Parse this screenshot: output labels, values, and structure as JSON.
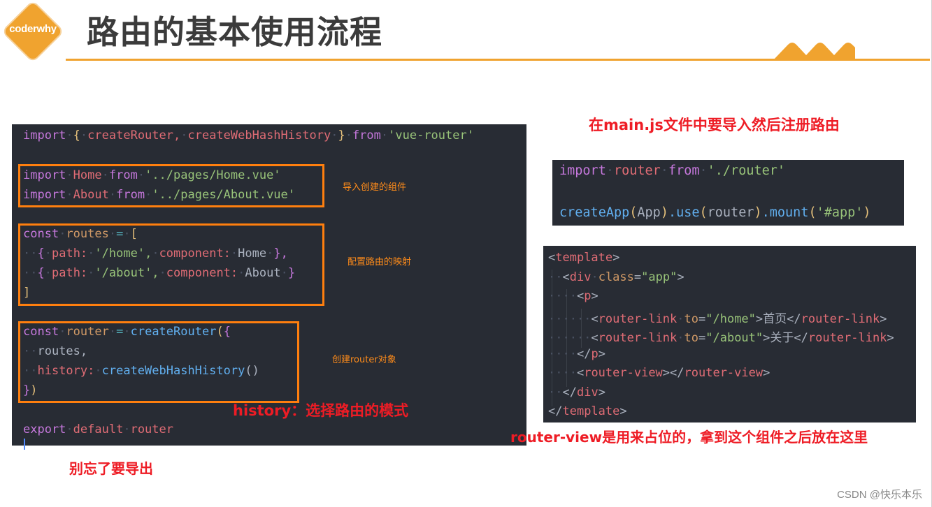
{
  "header": {
    "logo_text": "coderwhy",
    "title": "路由的基本使用流程",
    "accent_color": "#f0a32f"
  },
  "router_file": {
    "lines": {
      "l1": [
        "import",
        "{",
        "createRouter,",
        "createWebHashHistory",
        "}",
        "from",
        "'vue-router'"
      ],
      "l2": [
        "import",
        "Home",
        "from",
        "'../pages/Home.vue'"
      ],
      "l3": [
        "import",
        "About",
        "from",
        "'../pages/About.vue'"
      ],
      "l4": [
        "const",
        "routes",
        "=",
        "["
      ],
      "l5": [
        "{",
        "path:",
        "'/home',",
        "component:",
        "Home",
        "},"
      ],
      "l6": [
        "{",
        "path:",
        "'/about',",
        "component:",
        "About",
        "}"
      ],
      "l7": [
        "]"
      ],
      "l8": [
        "const",
        "router",
        "=",
        "createRouter",
        "(",
        "{"
      ],
      "l9": [
        "routes,"
      ],
      "l10": [
        "history:",
        "createWebHashHistory",
        "()"
      ],
      "l11": [
        "}",
        ")"
      ],
      "l12": [
        "export",
        "default",
        "router"
      ]
    },
    "annotations": {
      "import_components": "导入创建的组件",
      "route_mapping": "配置路由的映射",
      "create_router": "创建router对象",
      "history_mode": "history：选择路由的模式",
      "export_reminder": "别忘了要导出"
    }
  },
  "main_js": {
    "heading": "在main.js文件中要导入然后注册路由",
    "lines": {
      "l1": [
        "import",
        "router",
        "from",
        "'./router'"
      ],
      "l2": [
        "createApp",
        "(",
        "App",
        ")",
        ".use",
        "(",
        "router",
        ")",
        ".mount",
        "(",
        "'#app'",
        ")"
      ]
    }
  },
  "template_file": {
    "lines": {
      "l1": [
        "<",
        "template",
        ">"
      ],
      "l2": [
        "<",
        "div",
        "class",
        "=",
        "\"app\"",
        ">"
      ],
      "l3": [
        "<",
        "p",
        ">"
      ],
      "l4": [
        "<",
        "router-link",
        "to",
        "=",
        "\"/home\"",
        ">首页</",
        "router-link",
        ">"
      ],
      "l5": [
        "<",
        "router-link",
        "to",
        "=",
        "\"/about\"",
        ">关于</",
        "router-link",
        ">"
      ],
      "l6": [
        "</",
        "p",
        ">"
      ],
      "l7": [
        "<",
        "router-view",
        "></",
        "router-view",
        ">"
      ],
      "l8": [
        "</",
        "div",
        ">"
      ],
      "l9": [
        "</",
        "template",
        ">"
      ]
    },
    "note": "router-view是用来占位的，拿到这个组件之后放在这里"
  },
  "watermark": "CSDN @快乐本乐"
}
